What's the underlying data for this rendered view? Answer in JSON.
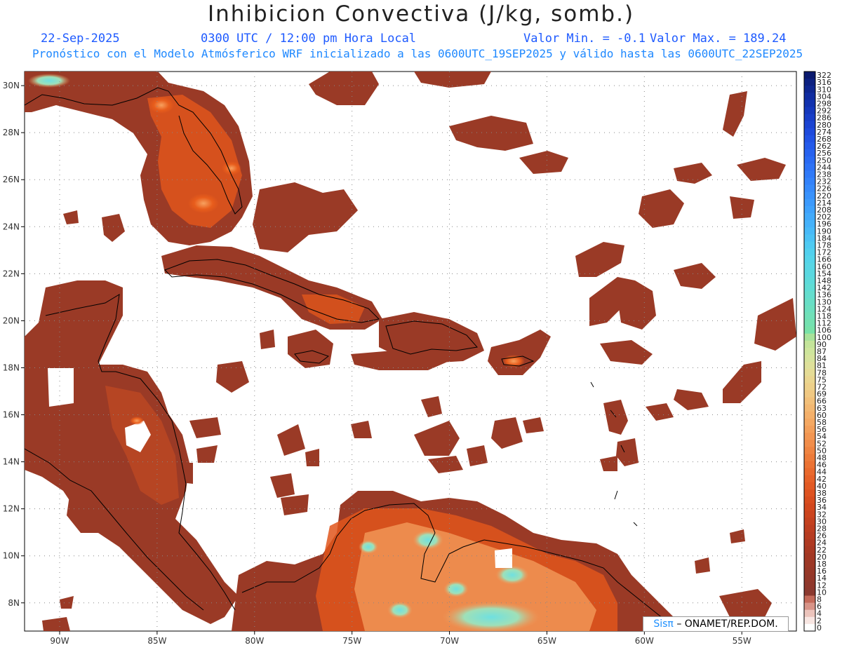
{
  "header": {
    "title": "Inhibicion Convectiva (J/kg, somb.)",
    "date": "22-Sep-2025",
    "time": "0300 UTC / 12:00 pm Hora Local",
    "min_label": "Valor Min. = -0.1",
    "max_label": "Valor Max. = 189.24",
    "model_info": "Pronóstico con el Modelo Atmósferico WRF inicializado a las 0600UTC_19SEP2025 y válido hasta las  0600UTC_22SEP2025"
  },
  "map": {
    "lon_range": [
      -91.8,
      -52.2
    ],
    "lat_range": [
      6.8,
      30.6
    ],
    "lon_ticks": [
      {
        "value": -90,
        "label": "90W"
      },
      {
        "value": -85,
        "label": "85W"
      },
      {
        "value": -80,
        "label": "80W"
      },
      {
        "value": -75,
        "label": "75W"
      },
      {
        "value": -70,
        "label": "70W"
      },
      {
        "value": -65,
        "label": "65W"
      },
      {
        "value": -60,
        "label": "60W"
      },
      {
        "value": -55,
        "label": "55W"
      }
    ],
    "lat_ticks": [
      {
        "value": 30,
        "label": "30N"
      },
      {
        "value": 28,
        "label": "28N"
      },
      {
        "value": 26,
        "label": "26N"
      },
      {
        "value": 24,
        "label": "24N"
      },
      {
        "value": 22,
        "label": "22N"
      },
      {
        "value": 20,
        "label": "20N"
      },
      {
        "value": 18,
        "label": "18N"
      },
      {
        "value": 16,
        "label": "16N"
      },
      {
        "value": 14,
        "label": "14N"
      },
      {
        "value": 12,
        "label": "12N"
      },
      {
        "value": 10,
        "label": "10N"
      },
      {
        "value": 8,
        "label": "8N"
      }
    ],
    "grid": true,
    "colors": {
      "base": "#9a3a26",
      "orange": "#e85d1c",
      "light": "#f39a5a",
      "cyan": "#5fd3d8",
      "coast": "#000000"
    }
  },
  "colorbar": {
    "levels": [
      "322",
      "316",
      "310",
      "304",
      "298",
      "292",
      "286",
      "280",
      "274",
      "268",
      "262",
      "256",
      "250",
      "244",
      "238",
      "232",
      "226",
      "220",
      "214",
      "208",
      "202",
      "196",
      "190",
      "184",
      "178",
      "172",
      "166",
      "160",
      "154",
      "148",
      "142",
      "136",
      "130",
      "124",
      "118",
      "112",
      "106",
      "100",
      "90",
      "87",
      "84",
      "81",
      "78",
      "75",
      "72",
      "69",
      "66",
      "63",
      "60",
      "58",
      "56",
      "54",
      "52",
      "50",
      "48",
      "46",
      "44",
      "42",
      "40",
      "38",
      "36",
      "34",
      "32",
      "30",
      "28",
      "26",
      "24",
      "22",
      "20",
      "18",
      "16",
      "14",
      "12",
      "10",
      "8",
      "6",
      "4",
      "2",
      "0"
    ],
    "colors": [
      "#0a1a6e",
      "#0c2080",
      "#0e2690",
      "#102ca0",
      "#1232ae",
      "#1538bc",
      "#183ec8",
      "#1b44d2",
      "#1e4adc",
      "#2152e4",
      "#245aea",
      "#2762ef",
      "#2a6af3",
      "#2d72f6",
      "#307af8",
      "#3382fa",
      "#368afb",
      "#3992fc",
      "#3c9afc",
      "#3fa2fc",
      "#42aafb",
      "#45b2fa",
      "#48baf8",
      "#4bc2f5",
      "#4ecaf2",
      "#51d0ee",
      "#54d4ea",
      "#57d6e5",
      "#5ad8e0",
      "#5ddada",
      "#60dcd4",
      "#64ddcd",
      "#68dec6",
      "#6cdfbf",
      "#70e0b8",
      "#74e1b0",
      "#78e2a8",
      "#a8e29a",
      "#c4e49a",
      "#cee59c",
      "#d6e39c",
      "#dee09a",
      "#e5dc96",
      "#ead690",
      "#edd08a",
      "#f0c882",
      "#f2c07a",
      "#f3b872",
      "#f4b06a",
      "#f4a862",
      "#f39f5a",
      "#f29652",
      "#f18d4a",
      "#ef8442",
      "#ed7b3a",
      "#eb7233",
      "#e9692d",
      "#e66128",
      "#e25a24",
      "#de5321",
      "#d84d1f",
      "#d2481e",
      "#cb441e",
      "#c4411f",
      "#bd3e20",
      "#b63c21",
      "#af3a22",
      "#a83923",
      "#a23824",
      "#9c3826",
      "#973828",
      "#93382a",
      "#8f382c",
      "#8b392f",
      "#c46a5a",
      "#d89488",
      "#ecc4bc",
      "#f8e6e2",
      "#ffffff"
    ]
  },
  "credit": {
    "sis": "Sisπ",
    "text": "– ONAMET/REP.DOM."
  }
}
